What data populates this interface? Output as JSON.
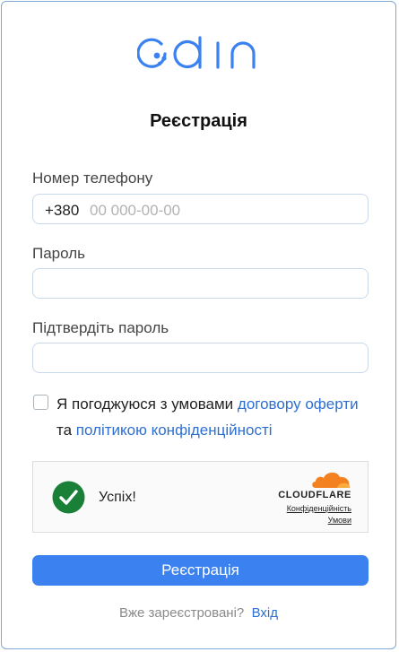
{
  "brand": {
    "logo_text": "edin",
    "color": "#3b82f0"
  },
  "page_title": "Реєстрація",
  "phone": {
    "label": "Номер телефону",
    "prefix": "+380",
    "placeholder": "00 000-00-00",
    "value": ""
  },
  "password": {
    "label": "Пароль",
    "value": ""
  },
  "confirm_password": {
    "label": "Підтвердіть пароль",
    "value": ""
  },
  "agreement": {
    "checked": false,
    "text_before": "Я погоджуюся з умовами ",
    "offer_link": "договору оферти",
    "middle": " та ",
    "privacy_link": "політикою конфіденційності"
  },
  "captcha": {
    "status": "Успіх!",
    "brand": "CLOUDFLARE",
    "privacy_link": "Конфіденційність",
    "terms_link": "Умови",
    "success_color": "#1a7f37",
    "cloud_color": "#f48120"
  },
  "submit_label": "Реєстрація",
  "footer": {
    "question": "Вже зареєстровані?",
    "login_link": "Вхід"
  }
}
